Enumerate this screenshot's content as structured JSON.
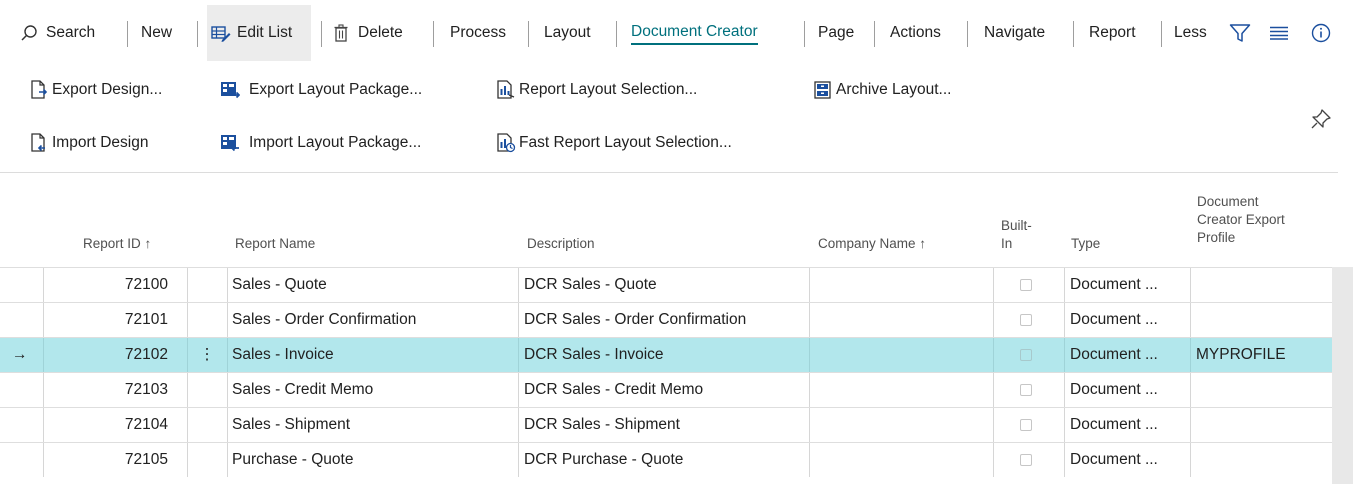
{
  "actionbar": {
    "search": "Search",
    "new": "New",
    "edit_list": "Edit List",
    "delete": "Delete",
    "process": "Process",
    "layout": "Layout",
    "document_creator": "Document Creator",
    "page": "Page",
    "actions": "Actions",
    "navigate": "Navigate",
    "report": "Report",
    "less": "Less"
  },
  "promoted": {
    "export_design": "Export Design...",
    "import_design": "Import Design",
    "export_layout_package": "Export Layout Package...",
    "import_layout_package": "Import Layout Package...",
    "report_layout_selection": "Report Layout Selection...",
    "fast_report_layout_selection": "Fast Report Layout Selection...",
    "archive_layout": "Archive Layout..."
  },
  "columns": {
    "report_id": "Report ID ↑",
    "report_name": "Report Name",
    "description": "Description",
    "company_name": "Company Name ↑",
    "built_in_1": "Built-",
    "built_in_2": "In",
    "type": "Type",
    "export_profile_1": "Document",
    "export_profile_2": "Creator Export",
    "export_profile_3": "Profile"
  },
  "rows": [
    {
      "id": "72100",
      "name": "Sales - Quote",
      "description": "DCR Sales - Quote",
      "company": "",
      "built_in": false,
      "type": "Document ...",
      "profile": "",
      "selected": false
    },
    {
      "id": "72101",
      "name": "Sales - Order Confirmation",
      "description": "DCR Sales - Order Confirmation",
      "company": "",
      "built_in": false,
      "type": "Document ...",
      "profile": "",
      "selected": false
    },
    {
      "id": "72102",
      "name": "Sales - Invoice",
      "description": "DCR Sales - Invoice",
      "company": "",
      "built_in": false,
      "type": "Document ...",
      "profile": "MYPROFILE",
      "selected": true
    },
    {
      "id": "72103",
      "name": "Sales - Credit Memo",
      "description": "DCR Sales - Credit Memo",
      "company": "",
      "built_in": false,
      "type": "Document ...",
      "profile": "",
      "selected": false
    },
    {
      "id": "72104",
      "name": "Sales - Shipment",
      "description": "DCR Sales - Shipment",
      "company": "",
      "built_in": false,
      "type": "Document ...",
      "profile": "",
      "selected": false
    },
    {
      "id": "72105",
      "name": "Purchase - Quote",
      "description": "DCR Purchase - Quote",
      "company": "",
      "built_in": false,
      "type": "Document ...",
      "profile": "",
      "selected": false
    }
  ],
  "selected_row_marker": "→",
  "row_menu_glyph": "⋮",
  "colors": {
    "accent": "#00707d",
    "selected_row": "#b2e7ec",
    "icon_blue": "#1b4f9e"
  },
  "icons": [
    "search-icon",
    "edit-list-icon",
    "delete-icon",
    "filter-icon",
    "list-icon",
    "info-icon",
    "export-design-icon",
    "import-design-icon",
    "export-layout-package-icon",
    "import-layout-package-icon",
    "report-layout-selection-icon",
    "fast-report-layout-selection-icon",
    "archive-layout-icon",
    "pin-icon"
  ]
}
